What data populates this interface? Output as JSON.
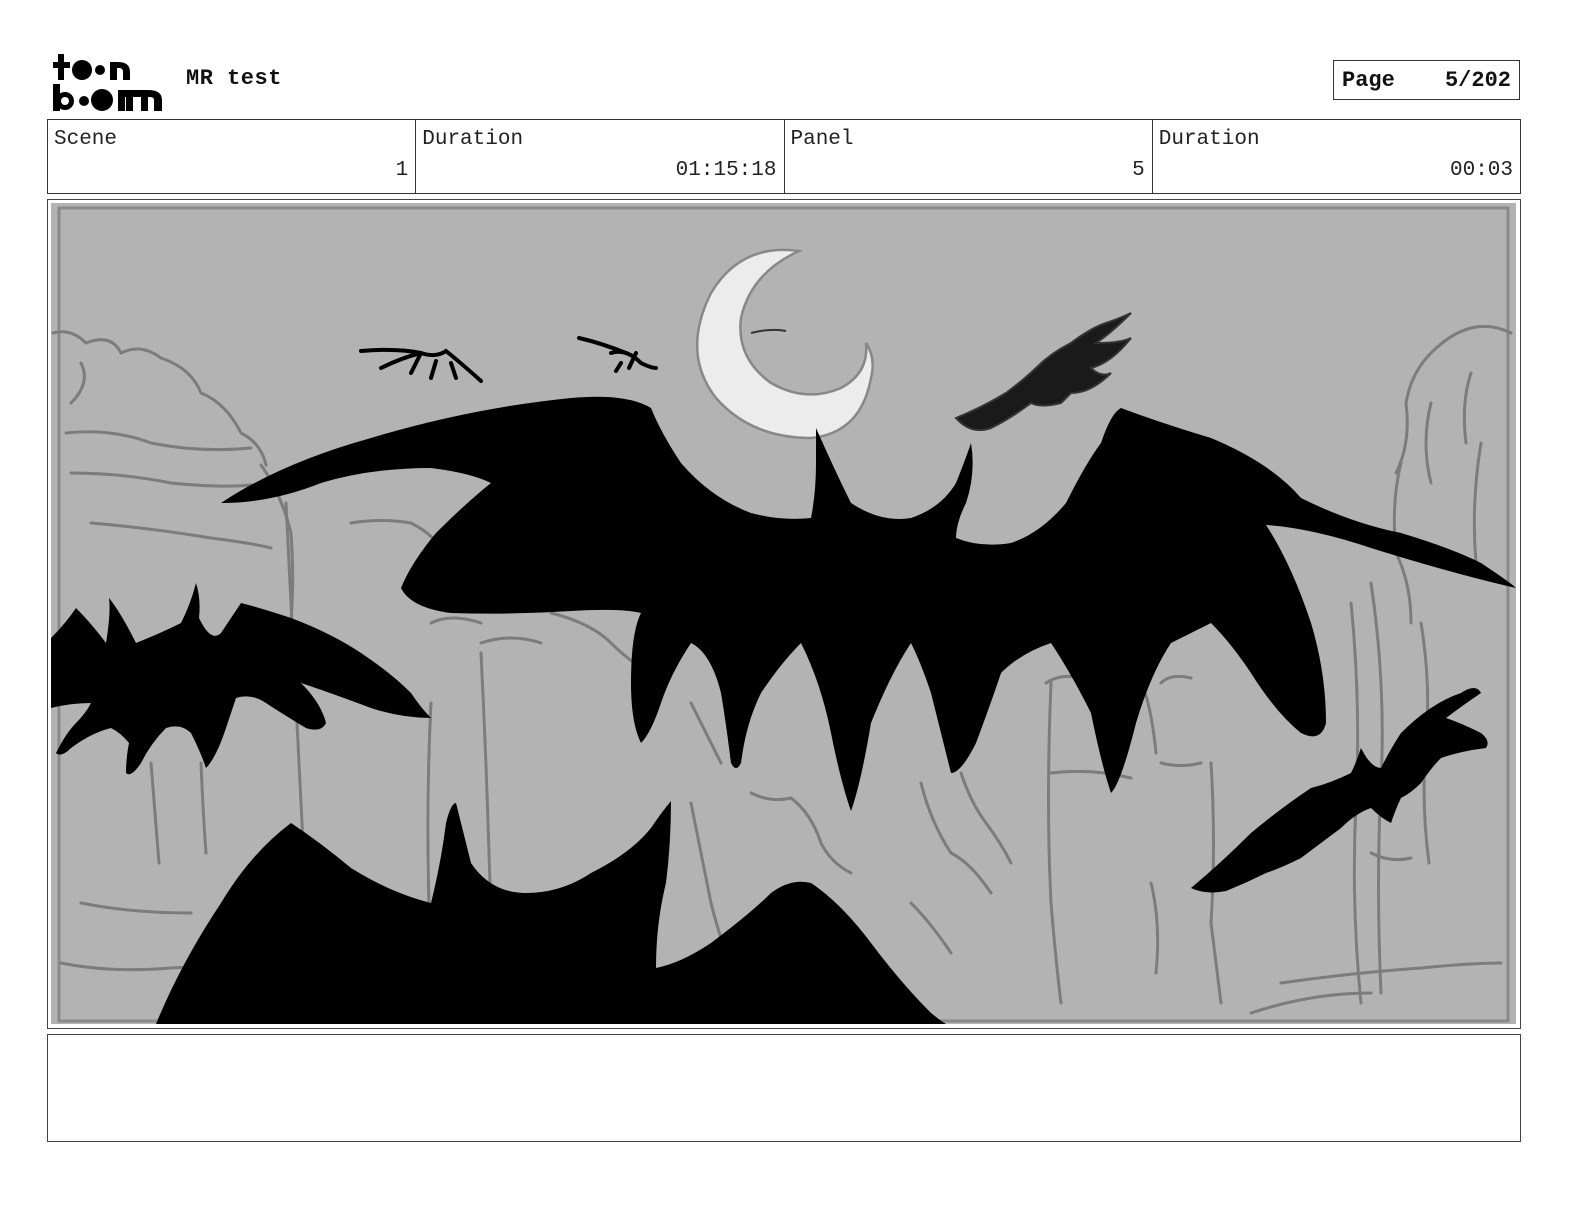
{
  "logo": {
    "line1": "to•n",
    "line2": "b••m",
    "icon": "toonboom-logo"
  },
  "project": {
    "title": "MR test"
  },
  "page": {
    "label": "Page",
    "number": "5/202"
  },
  "info": {
    "scene_label": "Scene",
    "scene_value": "1",
    "scene_duration_label": "Duration",
    "scene_duration_value": "01:15:18",
    "panel_label": "Panel",
    "panel_value": "5",
    "panel_duration_label": "Duration",
    "panel_duration_value": "00:03"
  },
  "panel_image": {
    "description_icon": "storyboard-sketch-bats-moon",
    "background_color": "#b3b3b3",
    "silhouette_color": "#000000",
    "moon_color": "#eeeeee"
  },
  "notes": {
    "text": ""
  }
}
